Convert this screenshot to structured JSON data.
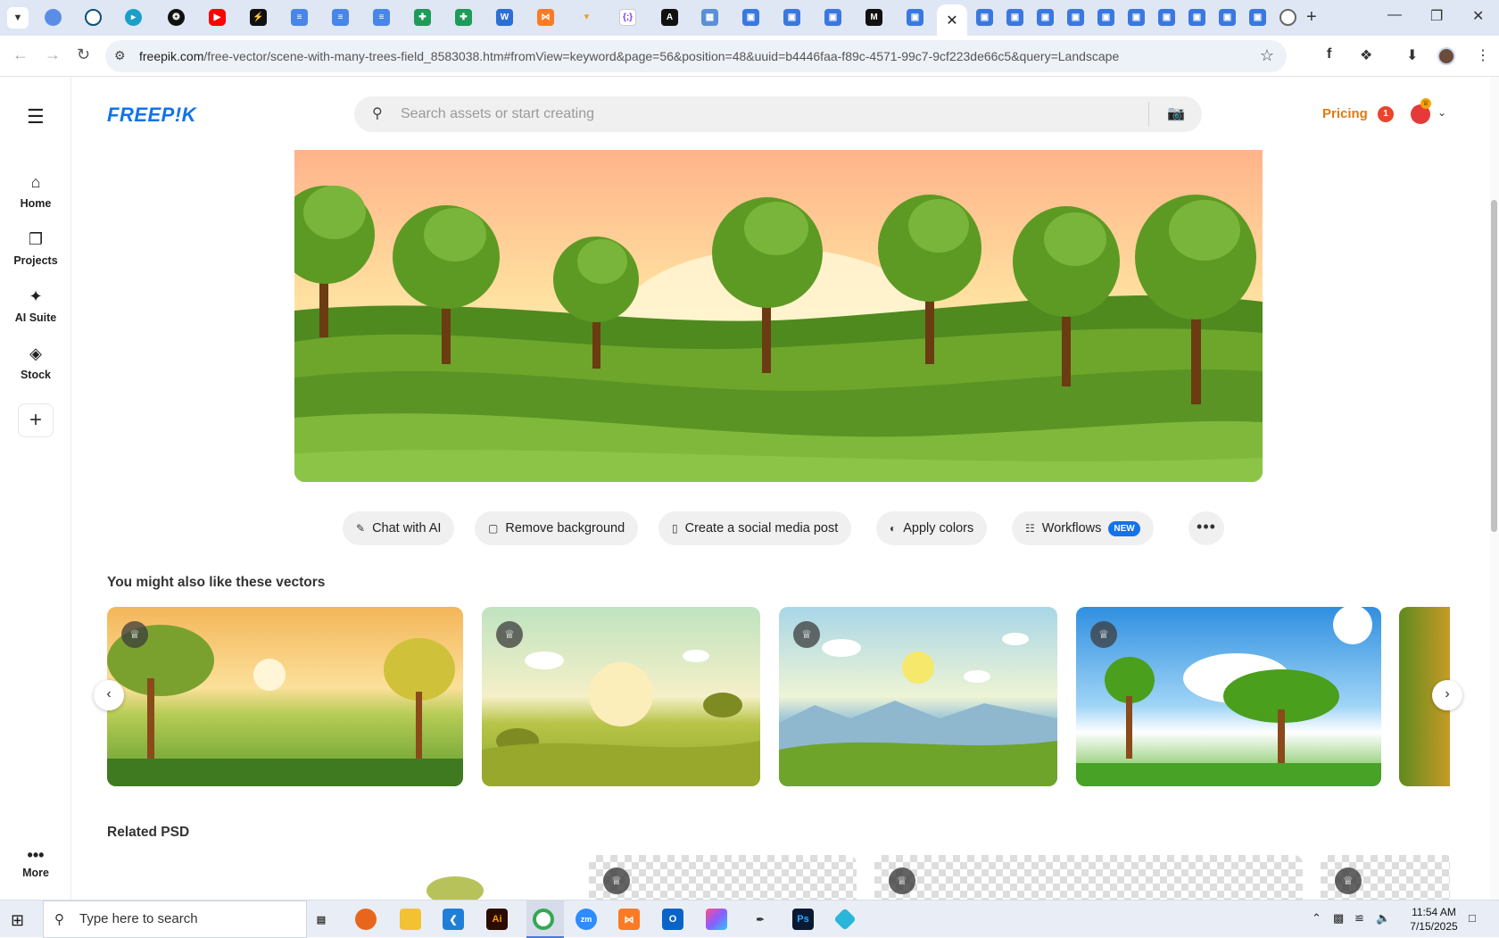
{
  "browser": {
    "url_host": "freepik.com",
    "url_path": "/free-vector/scene-with-many-trees-field_8583038.htm#fromView=keyword&page=56&position=48&uuid=b4446faa-f89c-4571-99c7-9cf223de66c5&query=Landscape",
    "tabs": [
      "globe-tab",
      "vpn-tab",
      "arrow-tab",
      "openai-tab",
      "youtube-tab",
      "bolt-tab",
      "docs-tab",
      "docs-tab",
      "docs-tab",
      "sheets-tab",
      "sheets-tab",
      "word-tab",
      "xampp-tab",
      "vercel-tab",
      "json-tab",
      "ai-tab",
      "grid-tab",
      "forms-tab",
      "forms-tab",
      "forms-tab",
      "medium-tab",
      "forms-tab",
      "freepik-active-tab",
      "forms-tab",
      "forms-tab",
      "forms-tab",
      "forms-tab",
      "forms-tab",
      "forms-tab",
      "forms-tab",
      "forms-tab",
      "forms-tab",
      "forms-tab",
      "chrome-tab"
    ]
  },
  "app": {
    "logo": "FREEP!K",
    "search_placeholder": "Search assets or start creating",
    "pricing_label": "Pricing",
    "notification_count": "1",
    "sidebar": [
      {
        "label": "Home",
        "icon": "home-icon"
      },
      {
        "label": "Projects",
        "icon": "projects-icon"
      },
      {
        "label": "AI Suite",
        "icon": "sparkles-icon"
      },
      {
        "label": "Stock",
        "icon": "stock-icon"
      }
    ],
    "sidebar_more": "More",
    "actions": [
      {
        "label": "Chat with AI",
        "icon": "chat-icon"
      },
      {
        "label": "Remove background",
        "icon": "remove-bg-icon"
      },
      {
        "label": "Create a social media post",
        "icon": "phone-icon"
      },
      {
        "label": "Apply colors",
        "icon": "palette-icon"
      },
      {
        "label": "Workflows",
        "icon": "workflow-icon",
        "badge": "NEW"
      }
    ],
    "related_vectors_title": "You might also like these vectors",
    "related_psd_title": "Related PSD"
  },
  "taskbar": {
    "search_placeholder": "Type here to search",
    "time": "11:54 AM",
    "date": "7/15/2025"
  }
}
